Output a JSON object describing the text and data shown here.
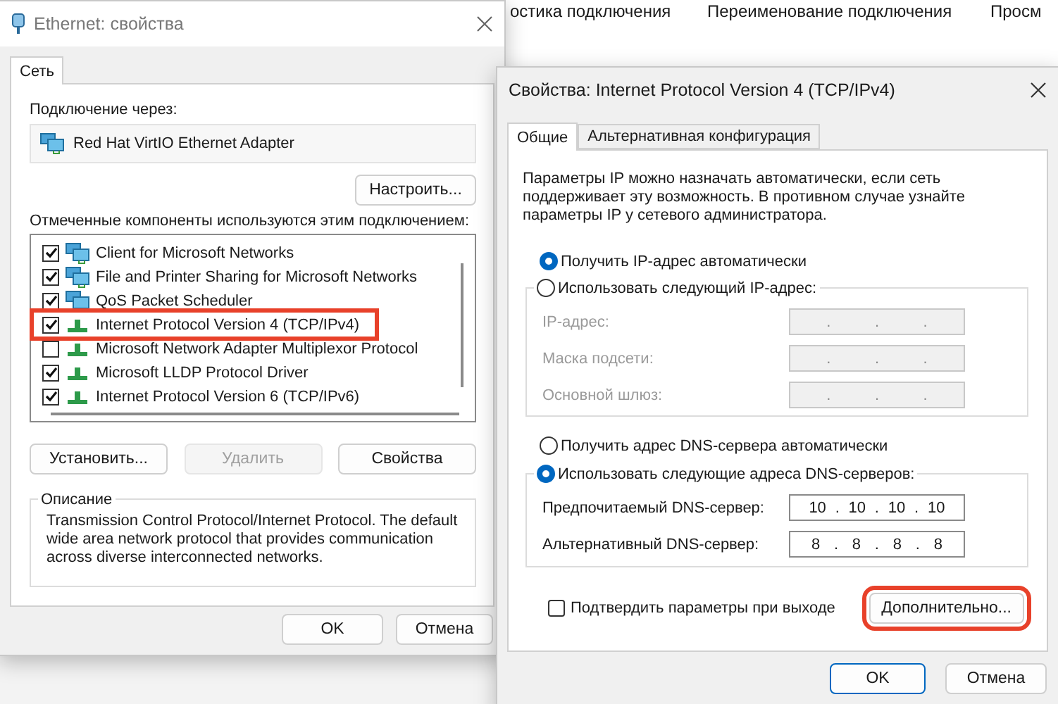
{
  "background_toolbar": {
    "items": [
      "остика подключения",
      "Переименование подключения",
      "Просм"
    ]
  },
  "ethernet_window": {
    "title": "Ethernet: свойства",
    "tabs": [
      {
        "label": "Сеть",
        "selected": true
      }
    ],
    "connect_using_label": "Подключение через:",
    "adapter": "Red Hat VirtIO Ethernet Adapter",
    "configure_button": "Настроить...",
    "components_label": "Отмеченные компоненты используются этим подключением:",
    "components": [
      {
        "kind": "service",
        "label": "Client for Microsoft Networks",
        "checked": true,
        "highlighted": false
      },
      {
        "kind": "service",
        "label": "File and Printer Sharing for Microsoft Networks",
        "checked": true,
        "highlighted": false
      },
      {
        "kind": "service",
        "label": "QoS Packet Scheduler",
        "checked": true,
        "highlighted": false
      },
      {
        "kind": "protocol",
        "label": "Internet Protocol Version 4 (TCP/IPv4)",
        "checked": true,
        "highlighted": true
      },
      {
        "kind": "protocol",
        "label": "Microsoft Network Adapter Multiplexor Protocol",
        "checked": false,
        "highlighted": false
      },
      {
        "kind": "protocol",
        "label": "Microsoft LLDP Protocol Driver",
        "checked": true,
        "highlighted": false
      },
      {
        "kind": "protocol",
        "label": "Internet Protocol Version 6 (TCP/IPv6)",
        "checked": true,
        "highlighted": false
      }
    ],
    "action_buttons": [
      {
        "label": "Установить...",
        "disabled": false
      },
      {
        "label": "Удалить",
        "disabled": true
      },
      {
        "label": "Свойства",
        "disabled": false
      }
    ],
    "description": {
      "title": "Описание",
      "text": "Transmission Control Protocol/Internet Protocol. The default wide area network protocol that provides communication across diverse interconnected networks."
    },
    "buttons": [
      {
        "label": "OK",
        "default": false
      },
      {
        "label": "Отмена",
        "default": false
      }
    ]
  },
  "ipv4_dialog": {
    "title": "Свойства: Internet Protocol Version 4 (TCP/IPv4)",
    "tabs": [
      {
        "label": "Общие",
        "selected": true
      },
      {
        "label": "Альтернативная конфигурация",
        "selected": false
      }
    ],
    "intro": "Параметры IP можно назначать автоматически, если сеть поддерживает эту возможность. В противном случае узнайте параметры IP у сетевого администратора.",
    "ip_mode": [
      {
        "label": "Получить IP-адрес автоматически",
        "selected": true
      },
      {
        "label": "Использовать следующий IP-адрес:",
        "selected": false
      }
    ],
    "ip_fields": [
      {
        "label": "IP-адрес:",
        "parts": [
          ".",
          ".",
          "."
        ],
        "disabled": true
      },
      {
        "label": "Маска подсети:",
        "parts": [
          ".",
          ".",
          "."
        ],
        "disabled": true
      },
      {
        "label": "Основной шлюз:",
        "parts": [
          ".",
          ".",
          "."
        ],
        "disabled": true
      }
    ],
    "dns_mode": [
      {
        "label": "Получить адрес DNS-сервера автоматически",
        "selected": false
      },
      {
        "label": "Использовать следующие адреса DNS-серверов:",
        "selected": true
      }
    ],
    "dns_fields": [
      {
        "label": "Предпочитаемый DNS-сервер:",
        "parts": [
          "10",
          ".",
          "10",
          ".",
          "10",
          ".",
          "10"
        ],
        "disabled": false
      },
      {
        "label": "Альтернативный DNS-сервер:",
        "parts": [
          "8",
          ".",
          "8",
          ".",
          "8",
          ".",
          "8"
        ],
        "disabled": false
      }
    ],
    "validate_checkbox": {
      "label": "Подтвердить параметры при выходе",
      "checked": false
    },
    "advanced_button": {
      "label": "Дополнительно...",
      "highlighted": true
    },
    "buttons": [
      {
        "label": "OK",
        "default": true
      },
      {
        "label": "Отмена",
        "default": false
      }
    ]
  }
}
